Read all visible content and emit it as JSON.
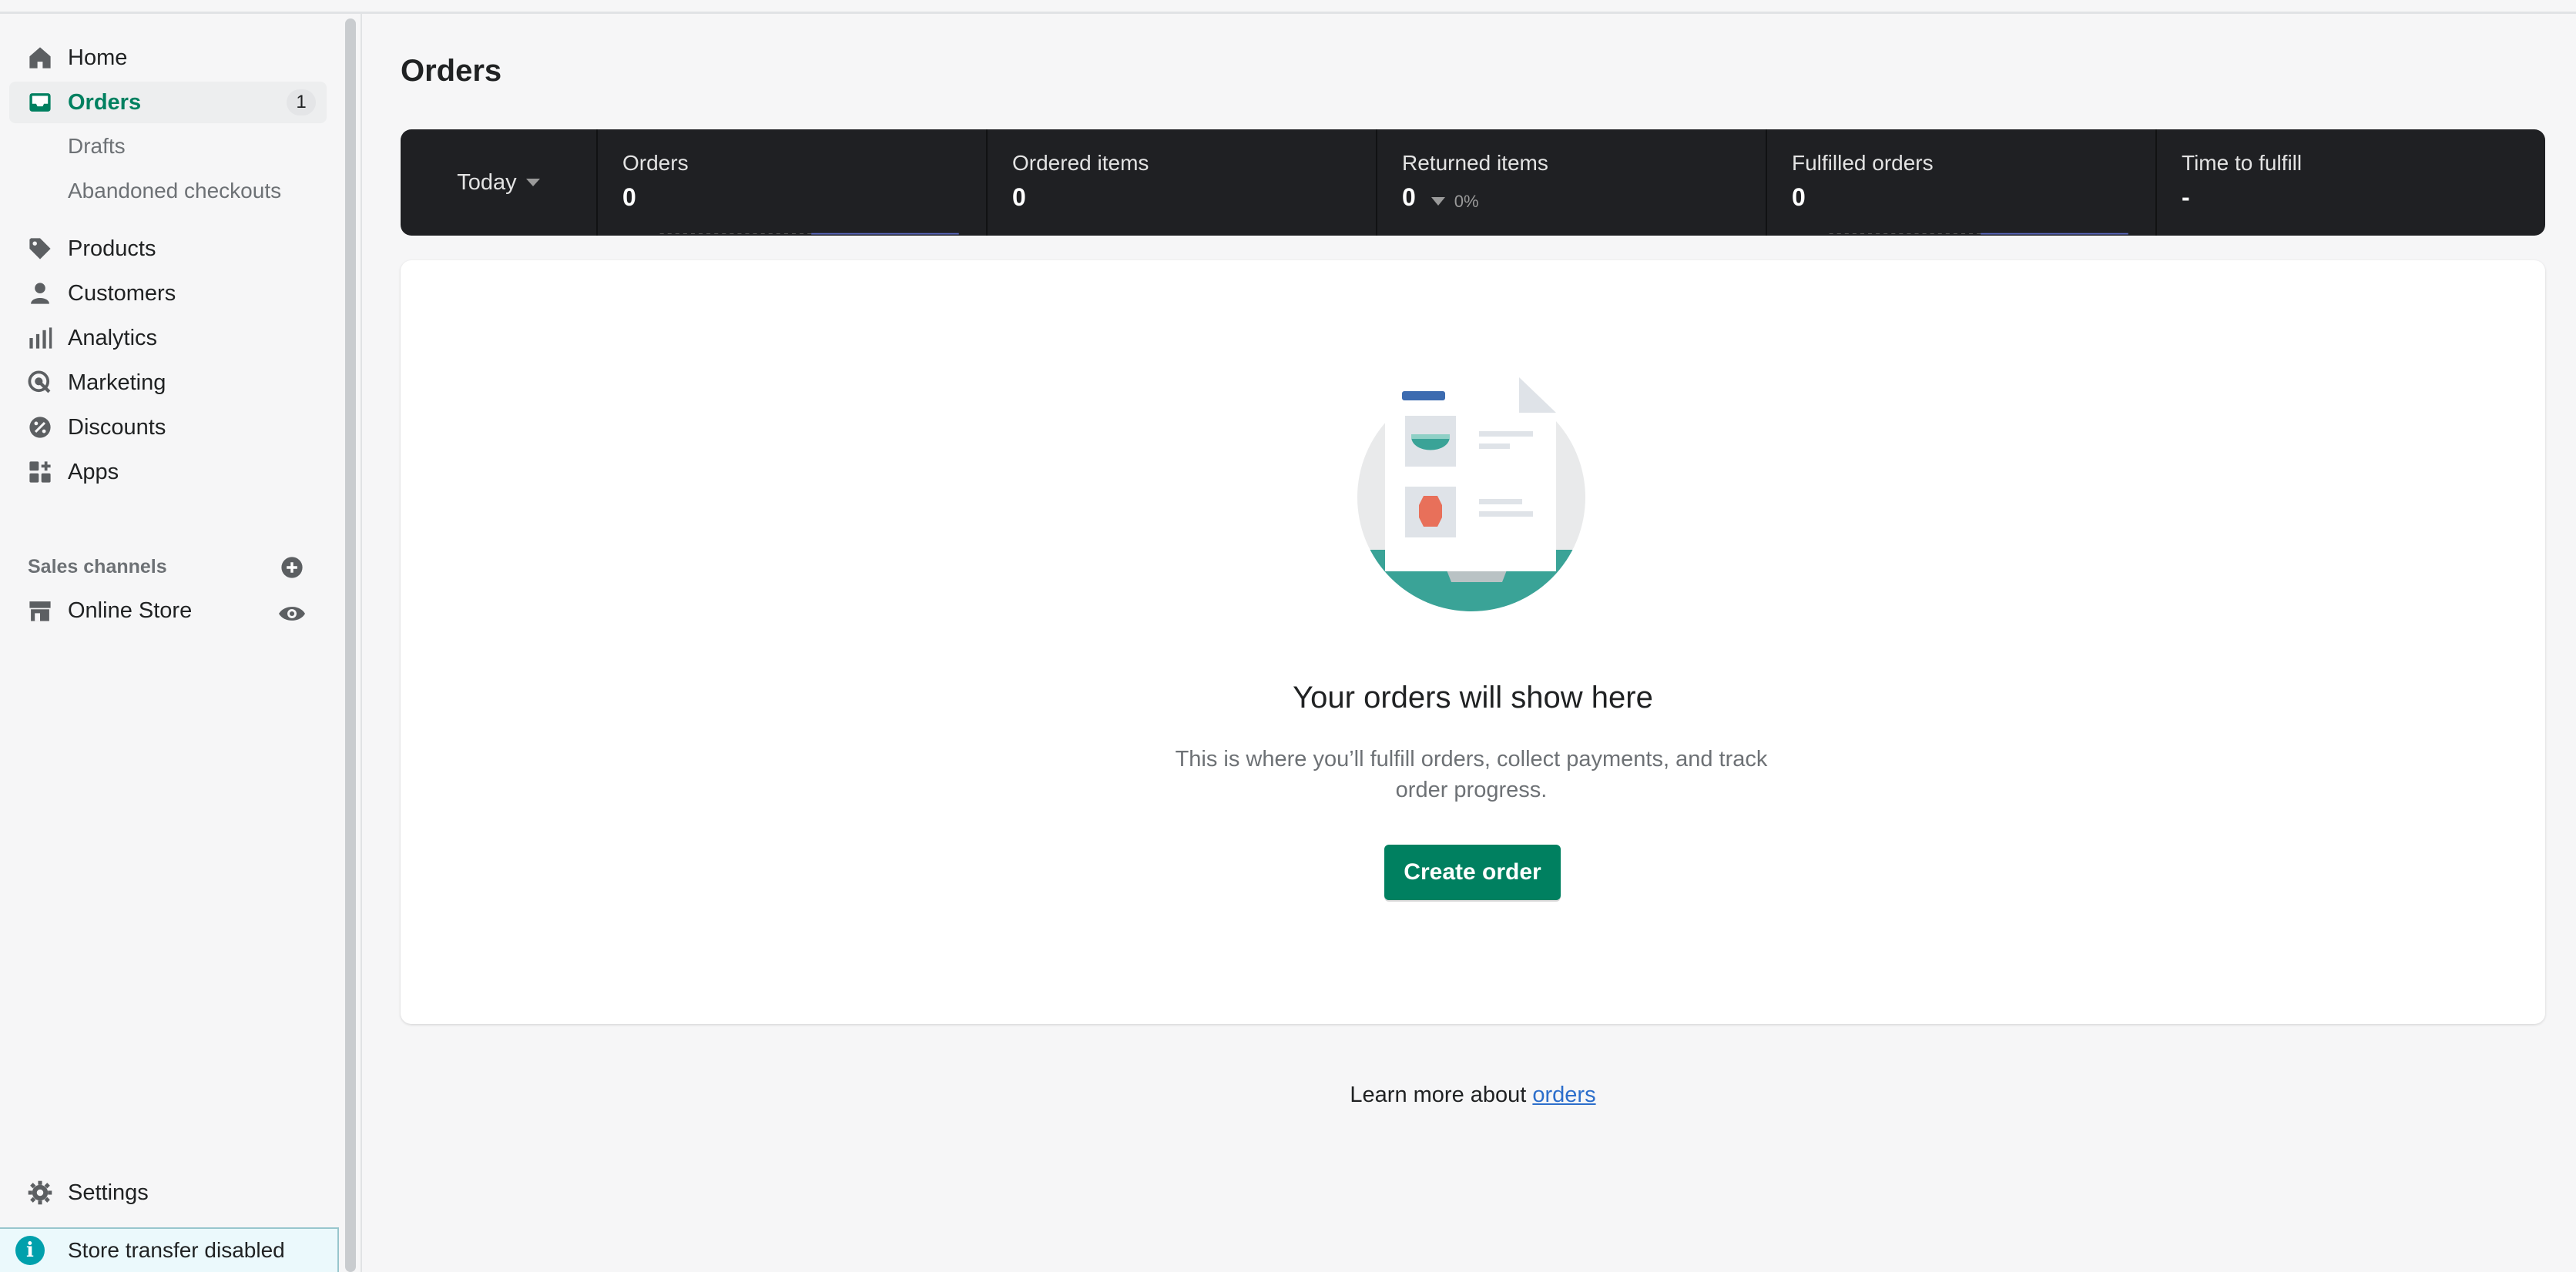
{
  "sidebar": {
    "items": [
      {
        "label": "Home",
        "icon": "home-icon"
      },
      {
        "label": "Orders",
        "icon": "inbox-icon",
        "badge": "1",
        "active": true
      },
      {
        "label": "Products",
        "icon": "tag-icon"
      },
      {
        "label": "Customers",
        "icon": "person-icon"
      },
      {
        "label": "Analytics",
        "icon": "bar-chart-icon"
      },
      {
        "label": "Marketing",
        "icon": "target-icon"
      },
      {
        "label": "Discounts",
        "icon": "discount-icon"
      },
      {
        "label": "Apps",
        "icon": "apps-icon"
      }
    ],
    "order_subitems": [
      "Drafts",
      "Abandoned checkouts"
    ],
    "sales_channels_title": "Sales channels",
    "online_store": "Online Store",
    "settings": "Settings",
    "store_banner": "Store transfer disabled"
  },
  "main": {
    "title": "Orders",
    "stats": {
      "date_range": "Today",
      "metrics": [
        {
          "label": "Orders",
          "value": "0"
        },
        {
          "label": "Ordered items",
          "value": "0"
        },
        {
          "label": "Returned items",
          "value": "0",
          "delta": "0%"
        },
        {
          "label": "Fulfilled orders",
          "value": "0"
        },
        {
          "label": "Time to fulfill",
          "value": "-"
        }
      ]
    },
    "empty_state": {
      "heading": "Your orders will show here",
      "text": "This is where you’ll fulfill orders, collect payments, and track order progress.",
      "button": "Create order"
    },
    "learn_more": {
      "prefix": "Learn more about ",
      "link": "orders"
    }
  },
  "colors": {
    "accent": "#008060",
    "stats_bg": "#1f2023",
    "link": "#2c6ecb",
    "sparkline": "#5c6ac4"
  }
}
